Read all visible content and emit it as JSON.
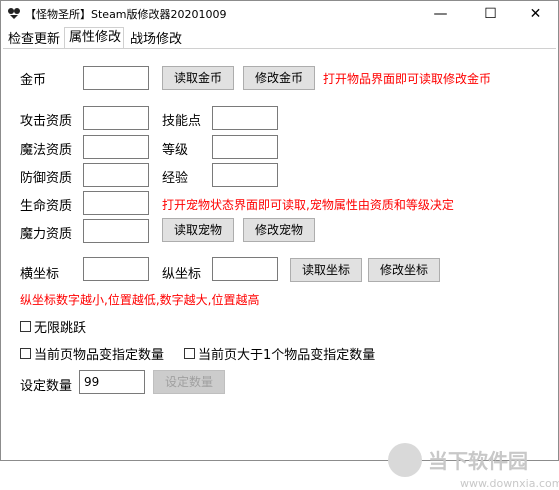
{
  "window": {
    "title": "【怪物圣所】Steam版修改器20201009",
    "minimize_glyph": "—",
    "maximize_glyph": "☐",
    "close_glyph": "✕"
  },
  "tabs": [
    {
      "label": "检查更新"
    },
    {
      "label": "属性修改"
    },
    {
      "label": "战场修改"
    }
  ],
  "gold": {
    "label": "金币",
    "value": "",
    "read_button": "读取金币",
    "modify_button": "修改金币",
    "hint": "打开物品界面即可读取修改金币"
  },
  "stats": {
    "attack_label": "攻击资质",
    "skill_points_label": "技能点",
    "magic_label": "魔法资质",
    "level_label": "等级",
    "defense_label": "防御资质",
    "exp_label": "经验",
    "hp_label": "生命资质",
    "mana_label": "魔力资质",
    "hint": "打开宠物状态界面即可读取,宠物属性由资质和等级决定",
    "read_pet_button": "读取宠物",
    "modify_pet_button": "修改宠物"
  },
  "coords": {
    "x_label": "横坐标",
    "y_label": "纵坐标",
    "read_button": "读取坐标",
    "modify_button": "修改坐标",
    "hint": "纵坐标数字越小,位置越低,数字越大,位置越高"
  },
  "options": {
    "infinite_jump": "无限跳跃",
    "page_items_qty": "当前页物品变指定数量",
    "page_items_gt1": "当前页大于1个物品变指定数量"
  },
  "quantity": {
    "label": "设定数量",
    "value": "99",
    "button": "设定数量"
  },
  "watermark": {
    "brand": "当下软件园",
    "url": "www.downxia.com"
  },
  "colors": {
    "hint_red": "#ff0000",
    "button_bg": "#e1e1e1"
  }
}
